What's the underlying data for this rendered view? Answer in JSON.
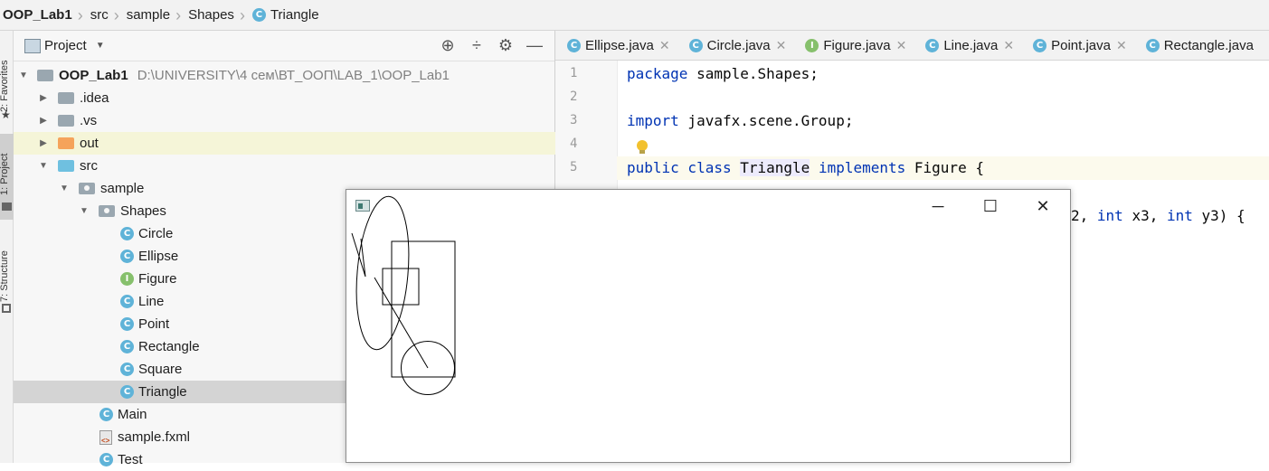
{
  "breadcrumb": {
    "project": "OOP_Lab1",
    "items": [
      "src",
      "sample",
      "Shapes",
      "Triangle"
    ]
  },
  "tool_strip": {
    "favorites": "2: Favorites",
    "project": "1: Project",
    "structure": "7: Structure"
  },
  "project_panel": {
    "title": "Project",
    "icons": [
      "locate-icon",
      "collapse-icon",
      "gear-icon",
      "minimize-icon"
    ],
    "tree": [
      {
        "label": "OOP_Lab1",
        "path": "D:\\UNIVERSITY\\4 сем\\ВТ_ООП\\LAB_1\\OOP_Lab1"
      },
      {
        "label": ".idea"
      },
      {
        "label": ".vs"
      },
      {
        "label": "out"
      },
      {
        "label": "src"
      },
      {
        "label": "sample"
      },
      {
        "label": "Shapes"
      },
      {
        "label": "Circle",
        "badge": "C"
      },
      {
        "label": "Ellipse",
        "badge": "C"
      },
      {
        "label": "Figure",
        "badge": "I"
      },
      {
        "label": "Line",
        "badge": "C"
      },
      {
        "label": "Point",
        "badge": "C"
      },
      {
        "label": "Rectangle",
        "badge": "C"
      },
      {
        "label": "Square",
        "badge": "C"
      },
      {
        "label": "Triangle",
        "badge": "C"
      },
      {
        "label": "Main",
        "badge": "C"
      },
      {
        "label": "sample.fxml"
      },
      {
        "label": "Test",
        "badge": "C"
      }
    ]
  },
  "editor_tabs": [
    {
      "label": "Ellipse.java",
      "badge": "C"
    },
    {
      "label": "Circle.java",
      "badge": "C"
    },
    {
      "label": "Figure.java",
      "badge": "I"
    },
    {
      "label": "Line.java",
      "badge": "C"
    },
    {
      "label": "Point.java",
      "badge": "C"
    },
    {
      "label": "Rectangle.java",
      "badge": "C"
    }
  ],
  "editor": {
    "line_numbers": [
      "1",
      "2",
      "3",
      "4",
      "5"
    ],
    "lines": [
      {
        "kw": "package",
        "rest": " sample.Shapes;"
      },
      {
        "kw": "",
        "rest": ""
      },
      {
        "kw": "import",
        "rest": " javafx.scene.Group;"
      },
      {
        "kw": "",
        "rest": ""
      },
      {
        "kw": "public class",
        "cls": "Triangle",
        "kw2": "implements",
        "rest": " Figure {"
      }
    ],
    "partial_line": {
      "a": "2, ",
      "kw1": "int",
      "b": " x3, ",
      "kw2": "int",
      "c": " y3) {"
    }
  },
  "app_window": {
    "icon": "app-window-icon",
    "controls": [
      "─",
      "☐",
      "✕"
    ]
  },
  "colors": {
    "keyword": "#0033b3",
    "class_badge": "#5fb3d8",
    "interface_badge": "#86c06c",
    "selection": "#d4d4d4"
  }
}
